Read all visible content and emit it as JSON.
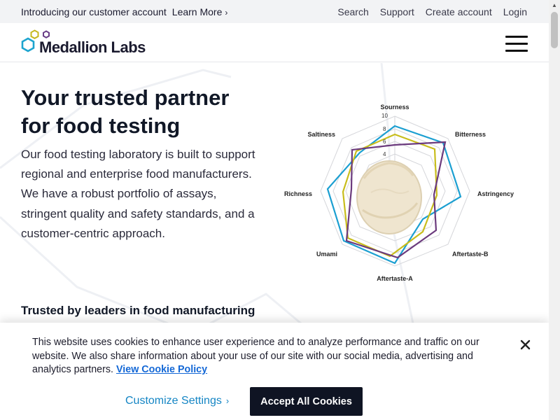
{
  "topbar": {
    "promo_text": "Introducing our customer account",
    "promo_link": "Learn More",
    "links": [
      "Search",
      "Support",
      "Create account",
      "Login"
    ]
  },
  "brand": {
    "name": "Medallion Labs",
    "hex_colors": [
      "#1da4cf",
      "#c5b81d",
      "#6a3f88"
    ]
  },
  "hero": {
    "title": "Your trusted partner for food testing",
    "description": "Our food testing laboratory is built to support regional and enterprise food manufacturers. We have a robust portfolio of assays, stringent quality and safety standards, and a customer-centric approach."
  },
  "radar": {
    "axes": [
      "Sourness",
      "Bitterness",
      "Astringency",
      "Aftertaste-B",
      "Aftertaste-A",
      "Umami",
      "Richness",
      "Saltiness"
    ],
    "scale_ticks": [
      "4",
      "6",
      "8",
      "10"
    ],
    "series_colors": [
      "#1b9fd1",
      "#c8bd1c",
      "#6b3a7d"
    ],
    "image": "ice-cream-scoop"
  },
  "trusted_heading": "Trusted by leaders in food manufacturing",
  "cookie": {
    "message": "This website uses cookies to enhance user experience and to analyze performance and traffic on our website. We also share information about your use of our site with our social media, advertising and analytics partners.",
    "policy_link": "View Cookie Policy",
    "customize_label": "Customize Settings",
    "accept_label": "Accept All Cookies",
    "close_icon": "close-icon"
  }
}
